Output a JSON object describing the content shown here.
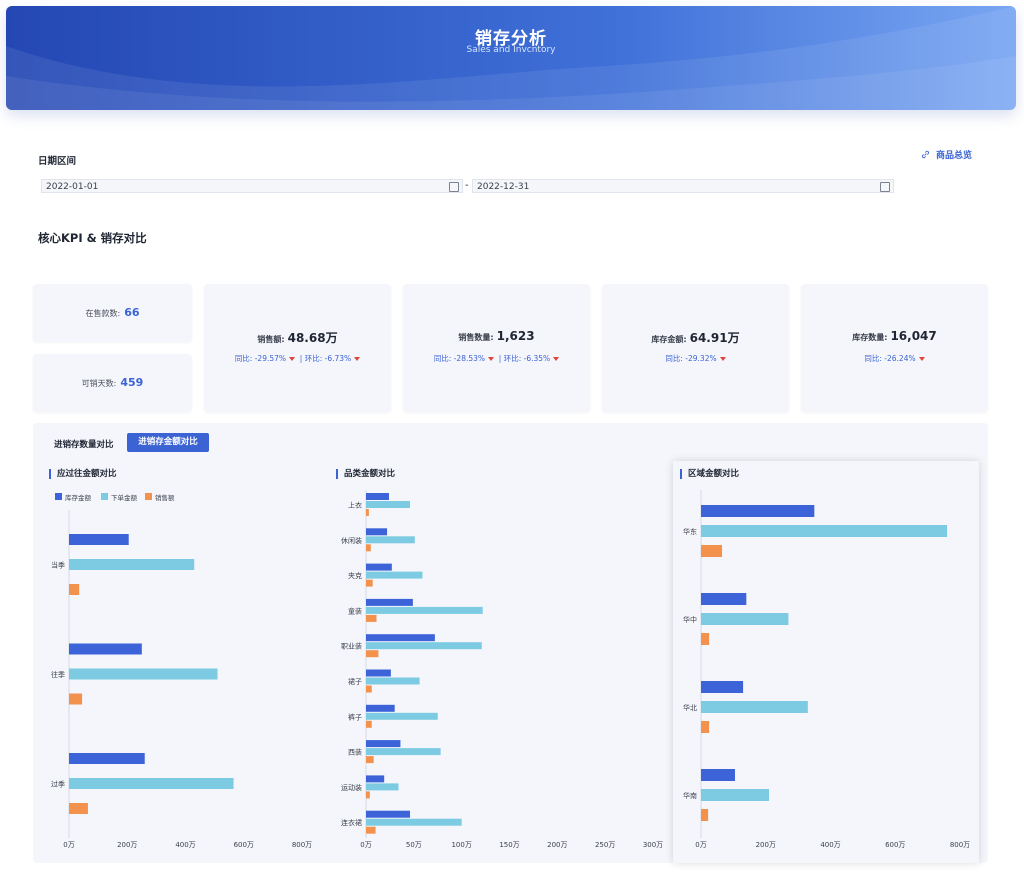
{
  "header": {
    "title": "销存分析",
    "subtitle": "Sales and Invcntory"
  },
  "filter": {
    "label": "日期区间",
    "start": "2022-01-01",
    "end": "2022-12-31",
    "separator": "-"
  },
  "overview_link": "商品总览",
  "section_title": "核心KPI & 销存对比",
  "kpi": {
    "on_sale": {
      "label": "在售款数:",
      "value": "66"
    },
    "sell_days": {
      "label": "可销天数:",
      "value": "459"
    },
    "cards": [
      {
        "label": "销售额:",
        "value": "48.68万",
        "yoy": "同比: -29.57%",
        "mom": "环比: -6.73%"
      },
      {
        "label": "销售数量:",
        "value": "1,623",
        "yoy": "同比: -28.53%",
        "mom": "环比: -6.35%"
      },
      {
        "label": "库存金额:",
        "value": "64.91万",
        "yoy": "同比: -29.32%",
        "mom": ""
      },
      {
        "label": "库存数量:",
        "value": "16,047",
        "yoy": "同比: -26.24%",
        "mom": ""
      }
    ]
  },
  "tabs": [
    "进销存数量对比",
    "进销存金额对比"
  ],
  "colors": {
    "primary": "#3b63d4",
    "inventory": "#3d63d9",
    "order": "#7ccbe3",
    "sales": "#f3924d",
    "down": "#e5443a"
  },
  "chart_data": [
    {
      "type": "bar",
      "title": "应过往金额对比",
      "orientation": "horizontal",
      "categories": [
        "当季",
        "往季",
        "过季"
      ],
      "series": [
        {
          "name": "库存金额",
          "values": [
            205,
            250,
            260
          ]
        },
        {
          "name": "下单金额",
          "values": [
            430,
            510,
            565
          ]
        },
        {
          "name": "销售额",
          "values": [
            35,
            45,
            65
          ]
        }
      ],
      "xlim": [
        0,
        800
      ],
      "ticks": [
        "0万",
        "200万",
        "400万",
        "600万",
        "800万"
      ],
      "legend": "top-left"
    },
    {
      "type": "bar",
      "title": "品类金额对比",
      "orientation": "horizontal",
      "categories": [
        "上衣",
        "休闲装",
        "夹克",
        "童装",
        "职业装",
        "裙子",
        "裤子",
        "西装",
        "运动装",
        "连衣裙"
      ],
      "series": [
        {
          "name": "库存金额",
          "values": [
            24,
            22,
            27,
            49,
            72,
            26,
            30,
            36,
            19,
            46
          ]
        },
        {
          "name": "下单金额",
          "values": [
            46,
            51,
            59,
            122,
            121,
            56,
            75,
            78,
            34,
            100
          ]
        },
        {
          "name": "销售额",
          "values": [
            3,
            5,
            7,
            11,
            13,
            6,
            6,
            8,
            4,
            10
          ]
        }
      ],
      "xlim": [
        0,
        300
      ],
      "ticks": [
        "0万",
        "50万",
        "100万",
        "150万",
        "200万",
        "250万",
        "300万"
      ]
    },
    {
      "type": "bar",
      "title": "区域金额对比",
      "orientation": "horizontal",
      "categories": [
        "华东",
        "华中",
        "华北",
        "华南"
      ],
      "series": [
        {
          "name": "库存金额",
          "values": [
            350,
            140,
            130,
            105
          ]
        },
        {
          "name": "下单金额",
          "values": [
            760,
            270,
            330,
            210
          ]
        },
        {
          "name": "销售额",
          "values": [
            65,
            25,
            25,
            22
          ]
        }
      ],
      "xlim": [
        0,
        800
      ],
      "ticks": [
        "0万",
        "200万",
        "400万",
        "600万",
        "800万"
      ]
    }
  ]
}
